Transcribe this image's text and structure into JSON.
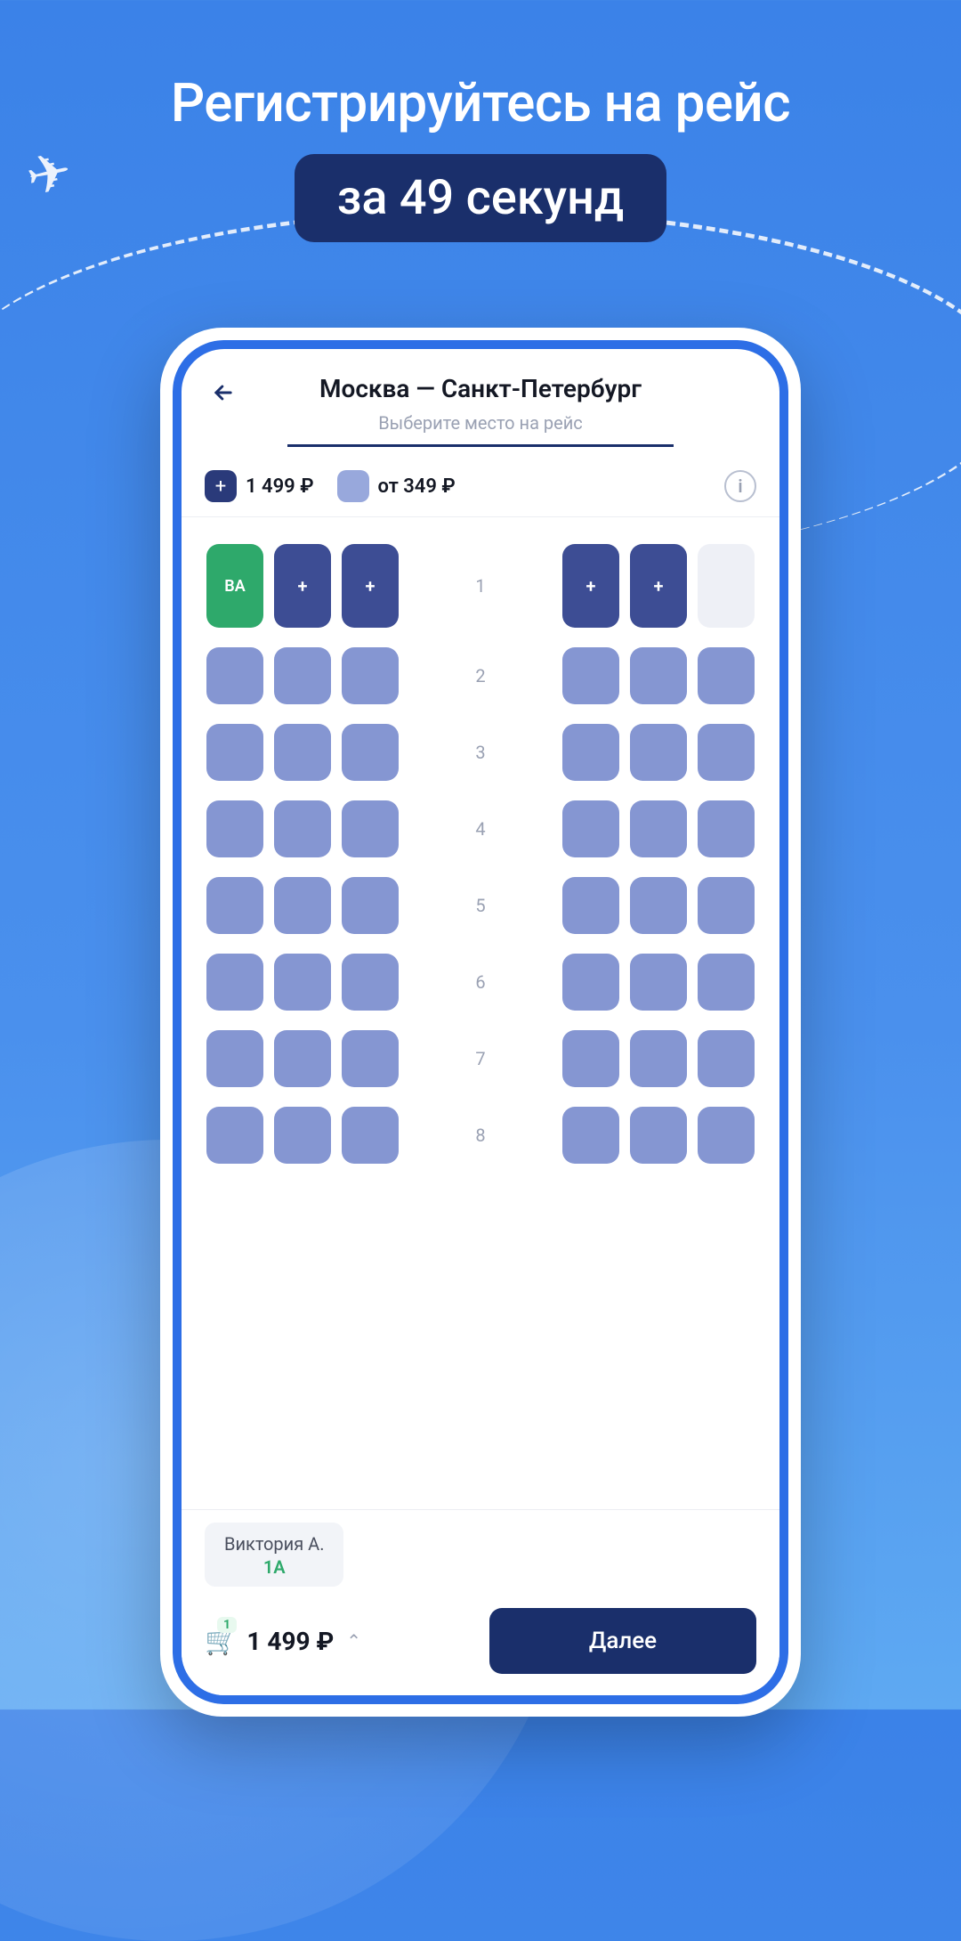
{
  "hero": {
    "title": "Регистрируйтесь на рейс",
    "badge": "за 49 секунд"
  },
  "header": {
    "route": "Москва — Санкт-Петербург",
    "subtitle": "Выберите место на рейс"
  },
  "legend": {
    "premium_price": "1 499 ₽",
    "standard_price": "от 349 ₽",
    "plus": "+"
  },
  "seatmap": {
    "rows": [
      {
        "num": "1",
        "left": [
          "selected",
          "premium-plus",
          "premium-plus"
        ],
        "right": [
          "premium-plus",
          "premium-plus",
          "unavailable"
        ],
        "tall": true,
        "selected_label": "ВА"
      },
      {
        "num": "2",
        "left": [
          "standard",
          "standard",
          "standard"
        ],
        "right": [
          "standard",
          "standard",
          "standard"
        ]
      },
      {
        "num": "3",
        "left": [
          "standard",
          "standard",
          "standard"
        ],
        "right": [
          "standard",
          "standard",
          "standard"
        ]
      },
      {
        "num": "4",
        "left": [
          "standard",
          "standard",
          "standard"
        ],
        "right": [
          "standard",
          "standard",
          "standard"
        ]
      },
      {
        "num": "5",
        "left": [
          "standard",
          "standard",
          "standard"
        ],
        "right": [
          "standard",
          "standard",
          "standard"
        ]
      },
      {
        "num": "6",
        "left": [
          "standard",
          "standard",
          "standard"
        ],
        "right": [
          "standard",
          "standard",
          "standard"
        ]
      },
      {
        "num": "7",
        "left": [
          "standard",
          "standard",
          "standard"
        ],
        "right": [
          "standard",
          "standard",
          "standard"
        ]
      },
      {
        "num": "8",
        "left": [
          "standard",
          "standard",
          "standard"
        ],
        "right": [
          "standard",
          "standard",
          "standard"
        ]
      }
    ]
  },
  "bottom": {
    "passenger_name": "Виктория А.",
    "passenger_seat": "1A",
    "cart_count": "1",
    "cart_price": "1 499 ₽",
    "next_label": "Далее"
  },
  "icons": {
    "info": "i",
    "plus": "+"
  }
}
